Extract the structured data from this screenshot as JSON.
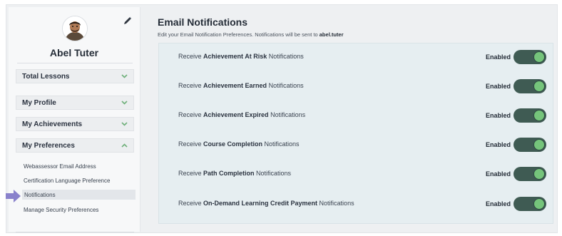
{
  "user": {
    "name": "Abel Tuter"
  },
  "sidebar": {
    "accordions": [
      {
        "label": "Total Lessons",
        "state": "collapsed"
      },
      {
        "label": "My Profile",
        "state": "collapsed"
      },
      {
        "label": "My Achievements",
        "state": "collapsed"
      },
      {
        "label": "My Preferences",
        "state": "expanded"
      }
    ],
    "preferences": [
      {
        "label": "Webassessor Email Address",
        "active": false
      },
      {
        "label": "Certification Language Preference",
        "active": false
      },
      {
        "label": "Notifications",
        "active": true
      },
      {
        "label": "Manage Security Preferences",
        "active": false
      }
    ]
  },
  "page": {
    "title": "Email Notifications",
    "subtitle_prefix": "Edit your Email Notification Preferences. Notifications will be sent to ",
    "subtitle_email": "abel.tuter"
  },
  "notifications": [
    {
      "prefix": "Receive ",
      "bold": "Achievement At Risk",
      "suffix": " Notifications",
      "status": "Enabled",
      "enabled": true
    },
    {
      "prefix": "Receive ",
      "bold": "Achievement Earned",
      "suffix": " Notifications",
      "status": "Enabled",
      "enabled": true
    },
    {
      "prefix": "Receive ",
      "bold": "Achievement Expired",
      "suffix": " Notifications",
      "status": "Enabled",
      "enabled": true
    },
    {
      "prefix": "Receive ",
      "bold": "Course Completion",
      "suffix": " Notifications",
      "status": "Enabled",
      "enabled": true
    },
    {
      "prefix": "Receive ",
      "bold": "Path Completion",
      "suffix": " Notifications",
      "status": "Enabled",
      "enabled": true
    },
    {
      "prefix": "Receive ",
      "bold": "On-Demand Learning Credit Payment",
      "suffix": " Notifications",
      "status": "Enabled",
      "enabled": true
    }
  ],
  "colors": {
    "toggle_track": "#3f5b53",
    "toggle_knob": "#75c47b",
    "pointer_arrow": "#8a82cc",
    "panel_bg": "#e6eef1"
  },
  "icons": {
    "edit": "pencil-icon",
    "collapsed": "chevron-down-icon",
    "expanded": "chevron-up-icon",
    "pointer": "arrow-right-icon"
  }
}
